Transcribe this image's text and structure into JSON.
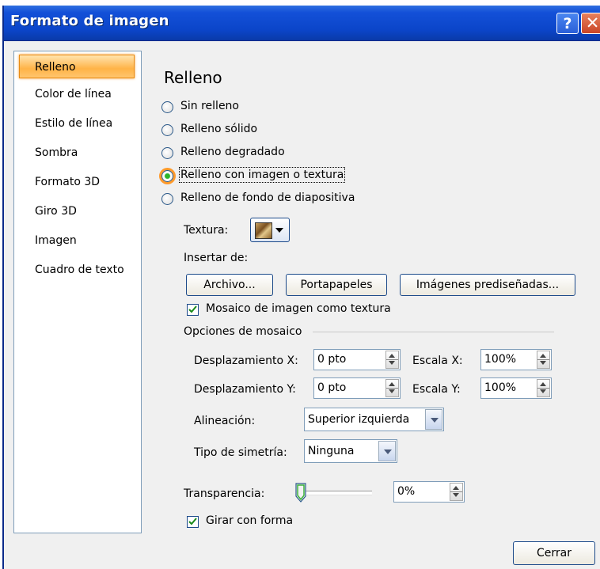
{
  "window": {
    "title": "Formato de imagen",
    "help_glyph": "?",
    "close_glyph": "✕"
  },
  "sidebar": {
    "items": [
      {
        "label": "Relleno",
        "selected": true
      },
      {
        "label": "Color de línea"
      },
      {
        "label": "Estilo de línea"
      },
      {
        "label": "Sombra"
      },
      {
        "label": "Formato 3D"
      },
      {
        "label": "Giro 3D"
      },
      {
        "label": "Imagen"
      },
      {
        "label": "Cuadro de texto"
      }
    ]
  },
  "fill": {
    "section_title": "Relleno",
    "options": [
      {
        "label": "Sin relleno",
        "checked": false
      },
      {
        "label": "Relleno sólido",
        "checked": false
      },
      {
        "label": "Relleno degradado",
        "checked": false
      },
      {
        "label": "Relleno con imagen o textura",
        "checked": true
      },
      {
        "label": "Relleno de fondo de diapositiva",
        "checked": false
      }
    ],
    "texture_label": "Textura:",
    "insert_from_label": "Insertar de:",
    "buttons": {
      "file": "Archivo...",
      "clipboard": "Portapapeles",
      "clipart": "Imágenes prediseñadas..."
    },
    "tile_checkbox": {
      "label": "Mosaico de imagen como textura",
      "checked": true
    },
    "tile_options_label": "Opciones de mosaico",
    "offset_x_label": "Desplazamiento X:",
    "offset_x_value": "0 pto",
    "offset_y_label": "Desplazamiento Y:",
    "offset_y_value": "0 pto",
    "scale_x_label": "Escala X:",
    "scale_x_value": "100%",
    "scale_y_label": "Escala Y:",
    "scale_y_value": "100%",
    "alignment_label": "Alineación:",
    "alignment_value": "Superior izquierda",
    "mirror_label": "Tipo de simetría:",
    "mirror_value": "Ninguna",
    "transparency_label": "Transparencia:",
    "transparency_value": "0%",
    "transparency_level": 0,
    "rotate_checkbox": {
      "label": "Girar con forma",
      "checked": true
    }
  },
  "footer": {
    "close_button": "Cerrar"
  }
}
